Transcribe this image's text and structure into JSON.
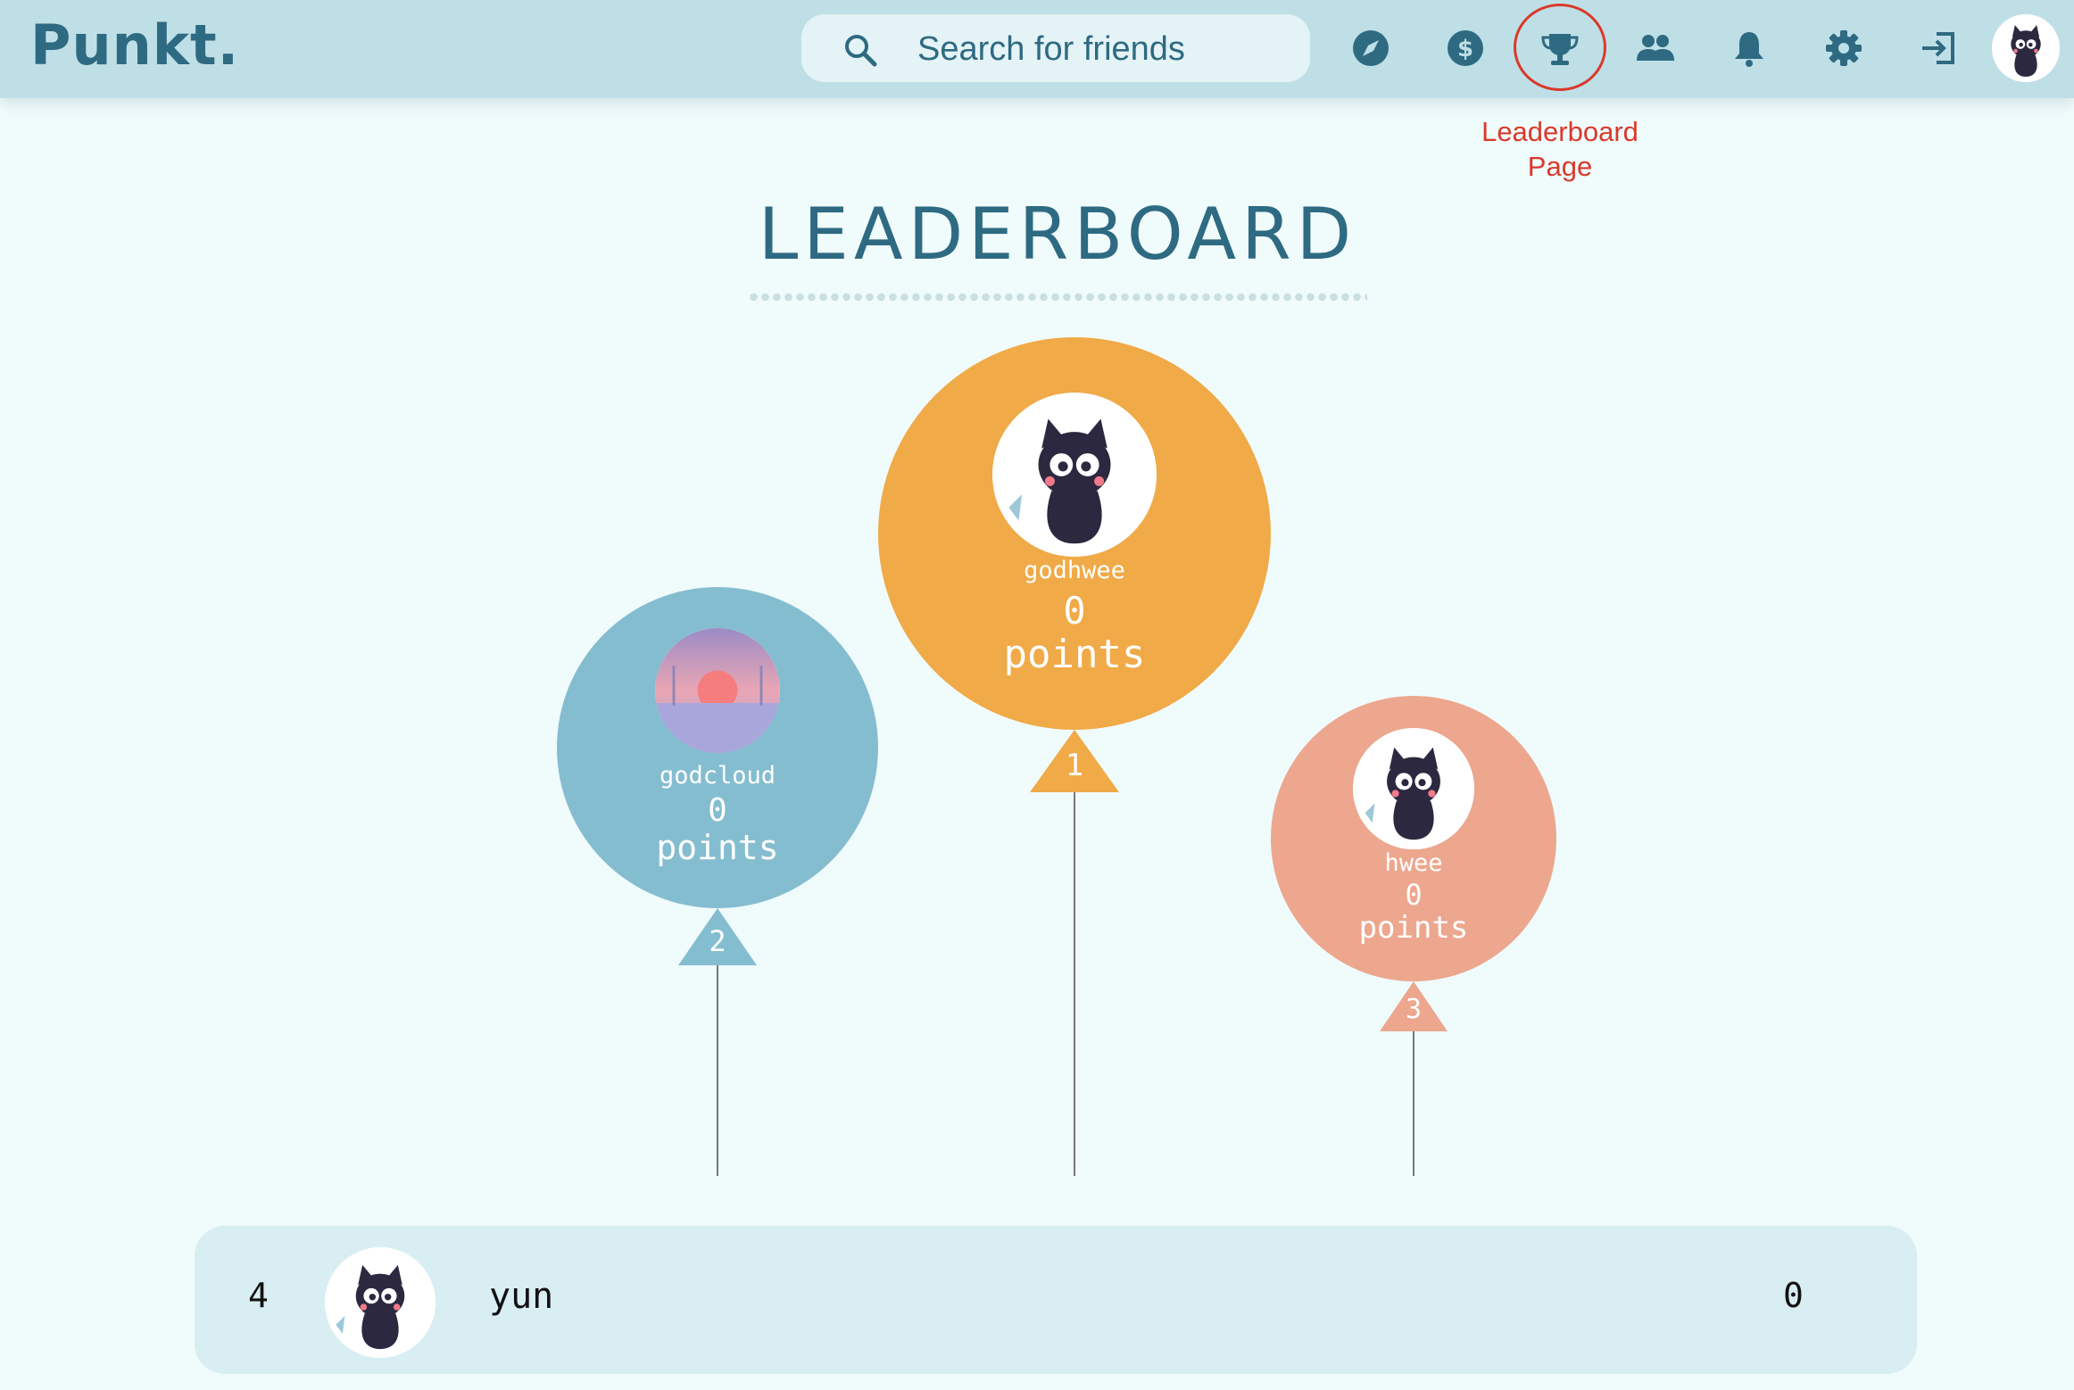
{
  "header": {
    "logo": "Punkt.",
    "search": {
      "placeholder": "Search for friends"
    },
    "nav_icons": [
      "explore-icon",
      "dollar-icon",
      "trophy-icon",
      "friends-icon",
      "bell-icon",
      "gear-icon",
      "logout-icon"
    ],
    "annotation": "Leaderboard\nPage"
  },
  "colors": {
    "header_bg": "#bfdfe6",
    "page_bg": "#f0fbfc",
    "accent": "#2e6a82",
    "first": "#f0aa47",
    "second": "#85bdd0",
    "third": "#eca78e",
    "annotation": "#d9392b"
  },
  "leaderboard": {
    "title": "LEADERBOARD",
    "podium": [
      {
        "rank": "1",
        "name": "godhwee",
        "points": "0",
        "points_label": "points"
      },
      {
        "rank": "2",
        "name": "godcloud",
        "points": "0",
        "points_label": "points"
      },
      {
        "rank": "3",
        "name": "hwee",
        "points": "0",
        "points_label": "points"
      }
    ],
    "rows": [
      {
        "rank": "4",
        "name": "yun",
        "points": "0"
      }
    ]
  }
}
